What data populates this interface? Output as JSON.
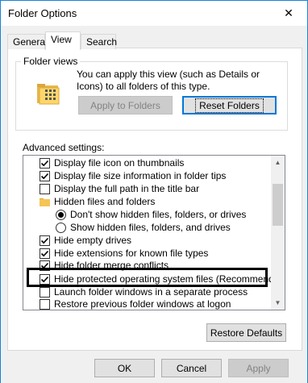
{
  "window": {
    "title": "Folder Options",
    "close_glyph": "✕"
  },
  "tabs": [
    {
      "label": "General"
    },
    {
      "label": "View"
    },
    {
      "label": "Search"
    }
  ],
  "folder_views": {
    "legend": "Folder views",
    "description": "You can apply this view (such as Details or Icons) to all folders of this type.",
    "apply_label": "Apply to Folders",
    "reset_label": "Reset Folders",
    "icon": "folder-icon"
  },
  "advanced": {
    "label": "Advanced settings:",
    "items": [
      {
        "type": "checkbox",
        "checked": true,
        "label": "Display file icon on thumbnails"
      },
      {
        "type": "checkbox",
        "checked": true,
        "label": "Display file size information in folder tips"
      },
      {
        "type": "checkbox",
        "checked": false,
        "label": "Display the full path in the title bar"
      },
      {
        "type": "folder",
        "label": "Hidden files and folders"
      },
      {
        "type": "radio",
        "checked": true,
        "label": "Don't show hidden files, folders, or drives"
      },
      {
        "type": "radio",
        "checked": false,
        "label": "Show hidden files, folders, and drives"
      },
      {
        "type": "checkbox",
        "checked": true,
        "label": "Hide empty drives"
      },
      {
        "type": "checkbox",
        "checked": true,
        "label": "Hide extensions for known file types"
      },
      {
        "type": "checkbox",
        "checked": true,
        "label": "Hide folder merge conflicts"
      },
      {
        "type": "checkbox",
        "checked": true,
        "label": "Hide protected operating system files (Recommended)"
      },
      {
        "type": "checkbox",
        "checked": false,
        "label": "Launch folder windows in a separate process"
      },
      {
        "type": "checkbox",
        "checked": false,
        "label": "Restore previous folder windows at logon"
      }
    ]
  },
  "restore_defaults_label": "Restore Defaults",
  "footer": {
    "ok": "OK",
    "cancel": "Cancel",
    "apply": "Apply"
  },
  "colors": {
    "accent": "#0078d7",
    "title_border": "#1883d7",
    "disabled_text": "#838383"
  }
}
